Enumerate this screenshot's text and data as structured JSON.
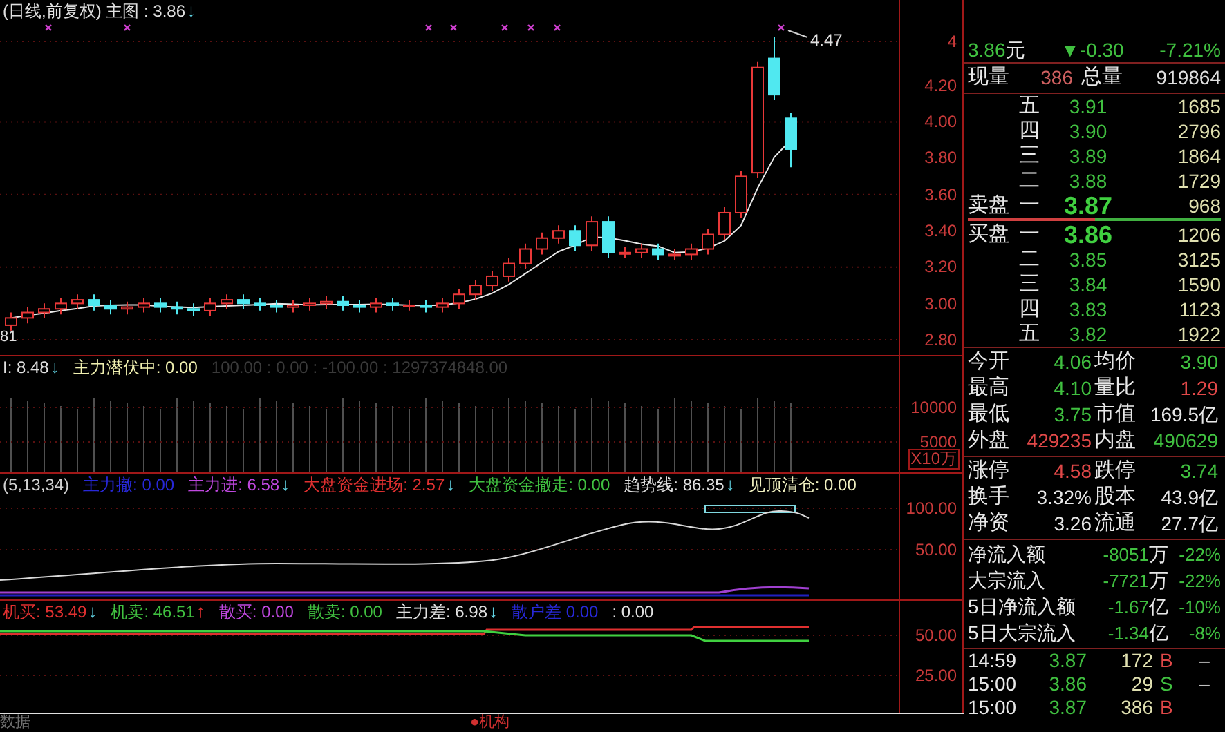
{
  "main_chart": {
    "legend": [
      {
        "text": "(日线,前复权) 主图 : 3.86",
        "color": "#e0e0e0",
        "arrow": {
          "text": "↓",
          "color": "#60d0e0"
        }
      }
    ],
    "high_label": "4.47",
    "low_label": "81",
    "axis_ticks": [
      "4",
      "4.20",
      "4.00",
      "3.80",
      "3.60",
      "3.40",
      "3.20",
      "3.00",
      "2.80"
    ]
  },
  "volume_panel": {
    "legend": [
      {
        "text": "I: 8.48",
        "color": "#e0e0e0",
        "arrow": {
          "text": "↓",
          "color": "#60d0e0"
        }
      },
      {
        "text": "主力潜伏中: 0.00",
        "color": "#f0f0b0"
      },
      {
        "text": "100.00 : 0.00 : -100.00 : 1297374848.00",
        "color": "#3a3a3a"
      }
    ],
    "axis_ticks": [
      "10000",
      "5000"
    ],
    "unit": "X10万"
  },
  "indicator_1": {
    "legend": [
      {
        "text": "(5,13,34)",
        "color": "#d0d0d0"
      },
      {
        "text": "主力撤: 0.00",
        "color": "#2828d8"
      },
      {
        "text": "主力进: 6.58",
        "color": "#c048e0",
        "arrow": {
          "text": "↓",
          "color": "#60d0e0"
        }
      },
      {
        "text": "大盘资金进场: 2.57",
        "color": "#e03030",
        "arrow": {
          "text": "↓",
          "color": "#60d0e0"
        }
      },
      {
        "text": "大盘资金撤走: 0.00",
        "color": "#40c040"
      },
      {
        "text": "趋势线: 86.35",
        "color": "#e0e0e0",
        "arrow": {
          "text": "↓",
          "color": "#60d0e0"
        }
      },
      {
        "text": "见顶清仓: 0.00",
        "color": "#f0f0c0"
      }
    ],
    "axis_ticks": [
      "100.00",
      "50.00"
    ]
  },
  "indicator_2": {
    "legend": [
      {
        "text": "机买: 53.49",
        "color": "#e03030",
        "arrow": {
          "text": "↓",
          "color": "#60d0e0"
        }
      },
      {
        "text": "机卖: 46.51",
        "color": "#40c040",
        "arrow": {
          "text": "↑",
          "color": "#e03030"
        }
      },
      {
        "text": "散买: 0.00",
        "color": "#c048e0"
      },
      {
        "text": "散卖: 0.00",
        "color": "#40c040"
      },
      {
        "text": "主力差: 6.98",
        "color": "#e0e0e0",
        "arrow": {
          "text": "↓",
          "color": "#60d0e0"
        }
      },
      {
        "text": "散户差 0.00",
        "color": "#2828d8"
      },
      {
        "text": ": 0.00",
        "color": "#e0e0e0"
      }
    ],
    "axis_ticks": [
      "50.00",
      "25.00"
    ]
  },
  "bottom_bar": {
    "left_label": "数据",
    "center_label": "●机构"
  },
  "quote": {
    "price": "3.86",
    "unit": "元",
    "change": "▼-0.30",
    "percent": "-7.21%"
  },
  "volume_row": {
    "label": "现量",
    "value": "386",
    "total_label": "总量",
    "total": "919864"
  },
  "asks": [
    {
      "kind": "level",
      "level": "五",
      "price": "3.91",
      "volume": "1685"
    },
    {
      "kind": "level",
      "level": "四",
      "price": "3.90",
      "volume": "2796"
    },
    {
      "kind": "level",
      "level": "三",
      "price": "3.89",
      "volume": "1864"
    },
    {
      "kind": "level",
      "level": "二",
      "price": "3.88",
      "volume": "1729"
    },
    {
      "kind": "best",
      "side_label": "卖盘",
      "level": "一",
      "price": "3.87",
      "volume": "968"
    }
  ],
  "bids": [
    {
      "kind": "best",
      "side_label": "买盘",
      "level": "一",
      "price": "3.86",
      "volume": "1206"
    },
    {
      "kind": "level",
      "level": "二",
      "price": "3.85",
      "volume": "3125"
    },
    {
      "kind": "level",
      "level": "三",
      "price": "3.84",
      "volume": "1590"
    },
    {
      "kind": "level",
      "level": "四",
      "price": "3.83",
      "volume": "1123"
    },
    {
      "kind": "level",
      "level": "五",
      "price": "3.82",
      "volume": "1922"
    }
  ],
  "stats": [
    [
      {
        "label": "今开",
        "value": "4.06",
        "color": "#40c040"
      },
      {
        "label": "均价",
        "value": "3.90",
        "color": "#40c040"
      }
    ],
    [
      {
        "label": "最高",
        "value": "4.10",
        "color": "#40c040"
      },
      {
        "label": "量比",
        "value": "1.29",
        "color": "#e04848"
      }
    ],
    [
      {
        "label": "最低",
        "value": "3.75",
        "color": "#40c040"
      },
      {
        "label": "市值",
        "value": "169.5亿",
        "color": "#e8e8e8"
      }
    ],
    [
      {
        "label": "外盘",
        "value": "429235",
        "color": "#e04848"
      },
      {
        "label": "内盘",
        "value": "490629",
        "color": "#40c040"
      }
    ]
  ],
  "stats_2": [
    [
      {
        "label": "涨停",
        "value": "4.58",
        "color": "#e04848"
      },
      {
        "label": "跌停",
        "value": "3.74",
        "color": "#40c040"
      }
    ],
    [
      {
        "label": "换手",
        "value": "3.32%",
        "color": "#e8e8e8"
      },
      {
        "label": "股本",
        "value": "43.9亿",
        "color": "#e8e8e8"
      }
    ],
    [
      {
        "label": "净资",
        "value": "3.26",
        "color": "#e8e8e8"
      },
      {
        "label": "流通",
        "value": "27.7亿",
        "color": "#e8e8e8"
      }
    ]
  ],
  "flows": [
    {
      "label": "净流入额",
      "amount": "-8051",
      "unit": "万",
      "percent": "-22%"
    },
    {
      "label": "大宗流入",
      "amount": "-7721",
      "unit": "万",
      "percent": "-22%"
    },
    {
      "label": "5日净流入额",
      "amount": "-1.67",
      "unit": "亿",
      "percent": "-10%"
    },
    {
      "label": "5日大宗流入",
      "amount": "-1.34",
      "unit": "亿",
      "percent": "-8%"
    }
  ],
  "trades": [
    {
      "time": "14:59",
      "price": "3.87",
      "volume": "172",
      "side": "B",
      "color": "#e04848",
      "mark": "–"
    },
    {
      "time": "15:00",
      "price": "3.86",
      "volume": "29",
      "side": "S",
      "color": "#40c040",
      "mark": "–"
    },
    {
      "time": "15:00",
      "price": "3.87",
      "volume": "386",
      "side": "B",
      "color": "#e04848"
    }
  ]
}
